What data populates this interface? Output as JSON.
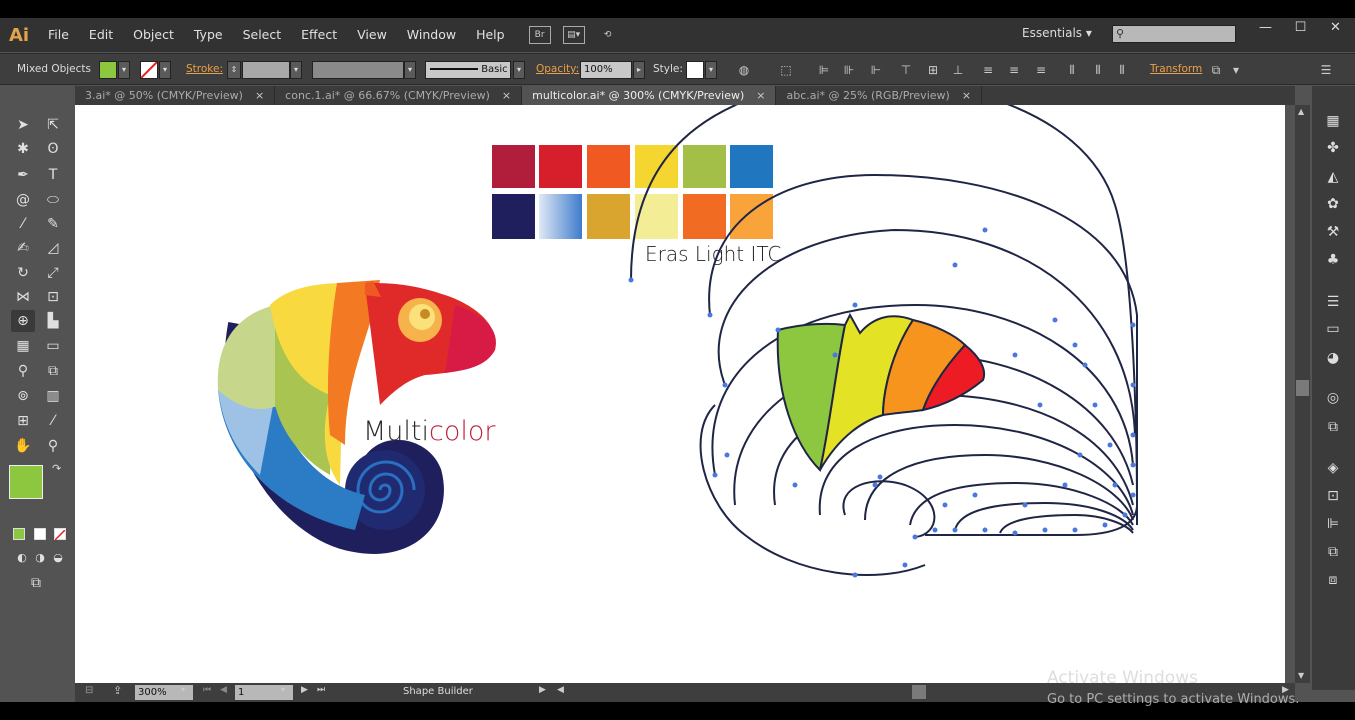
{
  "app": {
    "logo": "Ai"
  },
  "menu": [
    "File",
    "Edit",
    "Object",
    "Type",
    "Select",
    "Effect",
    "View",
    "Window",
    "Help"
  ],
  "menu_icons": {
    "bridge": "Br"
  },
  "workspace": "Essentials",
  "control": {
    "selection": "Mixed Objects",
    "fill_color": "#8dc63f",
    "stroke_label": "Stroke:",
    "brush": "Basic",
    "opacity_label": "Opacity:",
    "opacity_value": "100%",
    "style_label": "Style:",
    "transform_label": "Transform"
  },
  "tabs": [
    {
      "label": "3.ai* @ 50% (CMYK/Preview)",
      "close": "×"
    },
    {
      "label": "conc.1.ai* @ 66.67% (CMYK/Preview)",
      "close": "×"
    },
    {
      "label": "multicolor.ai* @ 300% (CMYK/Preview)",
      "close": "×"
    },
    {
      "label": "abc.ai* @ 25% (RGB/Preview)",
      "close": "×"
    }
  ],
  "canvas": {
    "logo_text_1": "Multi",
    "logo_text_2": "color",
    "font_label": "Eras Light ITC",
    "palette": [
      "#b01e3c",
      "#d71f2b",
      "#f05a22",
      "#f5d630",
      "#a3bf48",
      "#2176c0",
      "#1f1f5e",
      "#4a86cf",
      "#d9a52e",
      "#f3ee96",
      "#f26b22",
      "#f9a43b"
    ],
    "chameleon_segments": [
      "#8dc63f",
      "#e4e224",
      "#f7941d",
      "#ed1c24"
    ]
  },
  "status": {
    "zoom": "300%",
    "page": "1",
    "tool": "Shape Builder"
  },
  "watermark": {
    "line1": "Activate Windows",
    "line2": "Go to PC settings to activate Windows."
  }
}
